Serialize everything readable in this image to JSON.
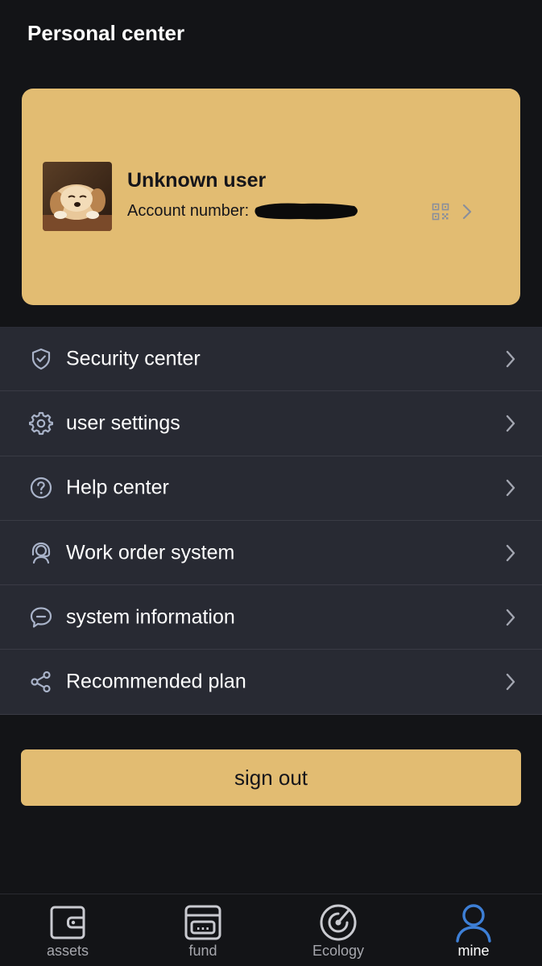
{
  "header": {
    "title": "Personal center"
  },
  "profile": {
    "name": "Unknown user",
    "account_label": "Account number:",
    "account_value": "",
    "avatar_icon": "puppy-avatar",
    "qr_icon": "qr-code-icon",
    "accent_color": "#e2bc72"
  },
  "menu": {
    "items": [
      {
        "label": "Security center",
        "icon": "shield-check-icon"
      },
      {
        "label": "user settings",
        "icon": "gear-icon"
      },
      {
        "label": "Help center",
        "icon": "question-circle-icon"
      },
      {
        "label": "Work order system",
        "icon": "support-agent-icon"
      },
      {
        "label": "system information",
        "icon": "chat-bubble-icon"
      },
      {
        "label": "Recommended plan",
        "icon": "share-icon"
      }
    ]
  },
  "actions": {
    "sign_out_label": "sign out"
  },
  "bottom_nav": {
    "active": "mine",
    "active_color": "#3d7fd6",
    "items": [
      {
        "label": "assets",
        "icon": "wallet-icon"
      },
      {
        "label": "fund",
        "icon": "calculator-card-icon"
      },
      {
        "label": "Ecology",
        "icon": "radar-icon"
      },
      {
        "label": "mine",
        "icon": "user-icon"
      }
    ]
  }
}
